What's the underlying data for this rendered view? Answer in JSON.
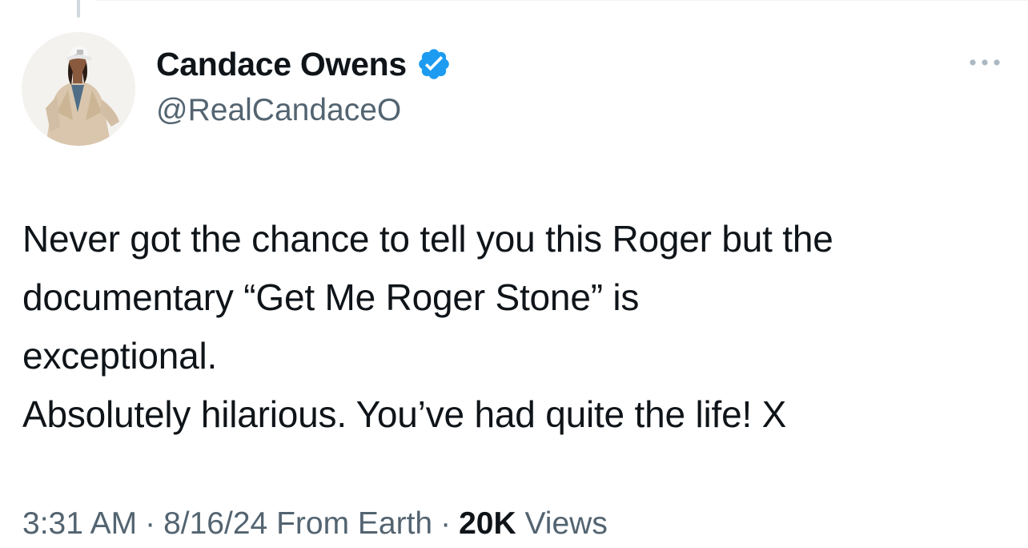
{
  "tweet": {
    "author": {
      "display_name": "Candace Owens",
      "handle": "@RealCandaceO",
      "verified": true,
      "verified_badge_icon": "verified-badge-icon",
      "avatar_icon": "profile-photo"
    },
    "more_icon": "more-options-icon",
    "text_lines": [
      "Never got the chance to tell you this Roger but the",
      "documentary “Get Me Roger Stone” is",
      "exceptional.",
      "Absolutely hilarious. You’ve had quite the life! X"
    ],
    "meta": {
      "time": "3:31 AM",
      "separator": "·",
      "date": "8/16/24",
      "source": "From Earth",
      "views_count": "20K",
      "views_label": "Views"
    }
  },
  "colors": {
    "text_primary": "#0f1419",
    "text_secondary": "#536471",
    "verified_blue": "#1d9bf0",
    "divider": "#eff3f4"
  }
}
